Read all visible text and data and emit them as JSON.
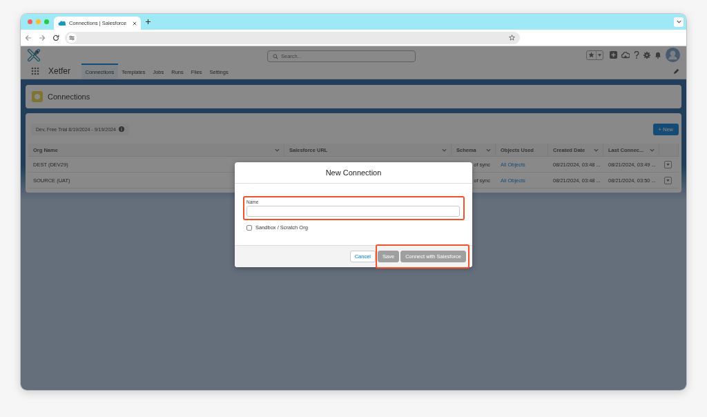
{
  "browser": {
    "tabs": [
      {
        "title": "Connections | Salesforce",
        "selected": true
      }
    ]
  },
  "app": {
    "name": "Xetfer",
    "search": {
      "placeholder": "Search..."
    },
    "nav": [
      {
        "label": "Connections",
        "selected": true
      },
      {
        "label": "Templates",
        "selected": false
      },
      {
        "label": "Jobs",
        "selected": false
      },
      {
        "label": "Runs",
        "selected": false
      },
      {
        "label": "Files",
        "selected": false
      },
      {
        "label": "Settings",
        "selected": false
      }
    ]
  },
  "page_header": {
    "title": "Connections"
  },
  "list": {
    "license_badge": "Dev, Free Trial 8/19/2024 - 9/19/2024",
    "new_button": "+ New",
    "columns": [
      {
        "label": "Org Name",
        "menu": true
      },
      {
        "label": "Salesforce URL",
        "menu": true
      },
      {
        "label": "Schema",
        "menu": true
      },
      {
        "label": "Objects Used",
        "menu": false
      },
      {
        "label": "Created Date",
        "menu": true
      },
      {
        "label": "Last Connec...",
        "menu": true
      }
    ],
    "rows": [
      {
        "org_name": "DEST (DEV29)",
        "schema": "of sync",
        "objects_used": "All Objects",
        "created_date": "08/21/2024, 03:48 ...",
        "last_connected": "08/21/2024, 03:49 ..."
      },
      {
        "org_name": "SOURCE (UAT)",
        "schema": "of sync",
        "objects_used": "All Objects",
        "created_date": "08/21/2024, 03:48 ...",
        "last_connected": "08/21/2024, 03:50 ..."
      }
    ]
  },
  "modal": {
    "title": "New Connection",
    "fields": [
      {
        "kind": "text",
        "label": "Name",
        "highlighted": true
      },
      {
        "kind": "checkbox",
        "label": "Sandbox / Scratch Org",
        "checked": false,
        "highlighted": false
      }
    ],
    "button_groups": [
      {
        "highlighted": false,
        "buttons": [
          {
            "label": "Cancel",
            "disabled": false
          }
        ]
      },
      {
        "highlighted": true,
        "buttons": [
          {
            "label": "Save",
            "disabled": true
          },
          {
            "label": "Connect with Salesforce",
            "disabled": true
          }
        ]
      }
    ]
  }
}
